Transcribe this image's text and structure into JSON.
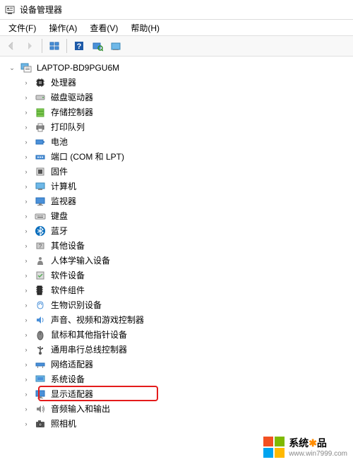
{
  "window": {
    "title": "设备管理器"
  },
  "menu": {
    "file": "文件(F)",
    "action": "操作(A)",
    "view": "查看(V)",
    "help": "帮助(H)"
  },
  "tree": {
    "root": "LAPTOP-BD9PGU6M",
    "items": [
      {
        "label": "处理器",
        "icon": "cpu"
      },
      {
        "label": "磁盘驱动器",
        "icon": "disk"
      },
      {
        "label": "存储控制器",
        "icon": "storage"
      },
      {
        "label": "打印队列",
        "icon": "printer"
      },
      {
        "label": "电池",
        "icon": "battery"
      },
      {
        "label": "端口 (COM 和 LPT)",
        "icon": "port"
      },
      {
        "label": "固件",
        "icon": "firmware"
      },
      {
        "label": "计算机",
        "icon": "computer"
      },
      {
        "label": "监视器",
        "icon": "monitor"
      },
      {
        "label": "键盘",
        "icon": "keyboard"
      },
      {
        "label": "蓝牙",
        "icon": "bluetooth"
      },
      {
        "label": "其他设备",
        "icon": "other"
      },
      {
        "label": "人体学输入设备",
        "icon": "hid"
      },
      {
        "label": "软件设备",
        "icon": "software"
      },
      {
        "label": "软件组件",
        "icon": "component"
      },
      {
        "label": "生物识别设备",
        "icon": "biometric"
      },
      {
        "label": "声音、视频和游戏控制器",
        "icon": "sound"
      },
      {
        "label": "鼠标和其他指针设备",
        "icon": "mouse"
      },
      {
        "label": "通用串行总线控制器",
        "icon": "usb"
      },
      {
        "label": "网络适配器",
        "icon": "network"
      },
      {
        "label": "系统设备",
        "icon": "system"
      },
      {
        "label": "显示适配器",
        "icon": "display",
        "highlighted": true
      },
      {
        "label": "音频输入和输出",
        "icon": "audio"
      },
      {
        "label": "照相机",
        "icon": "camera"
      }
    ]
  },
  "watermark": {
    "brand": "系统",
    "suffix": "品",
    "url": "www.win7999.com"
  }
}
